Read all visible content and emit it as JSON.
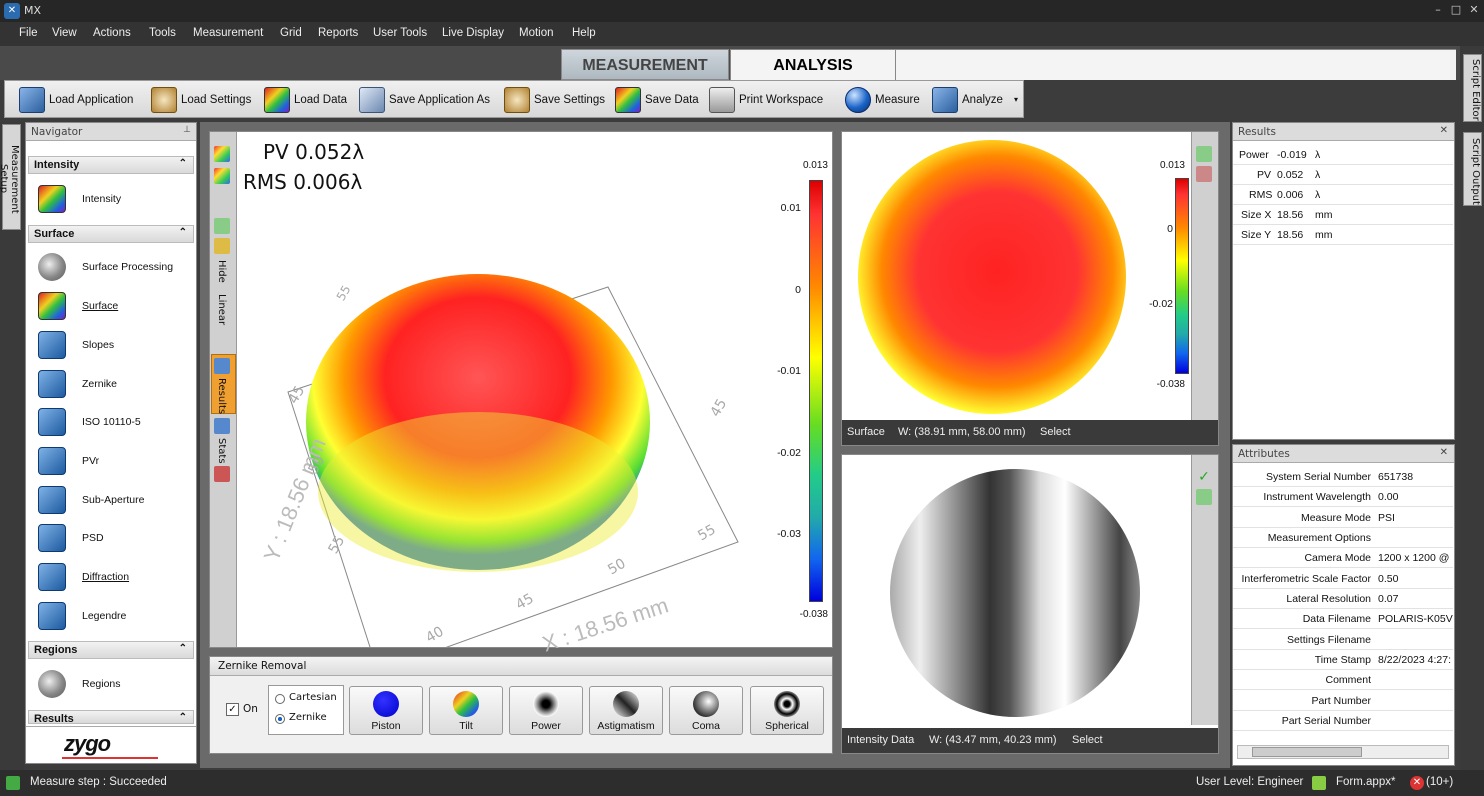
{
  "app": {
    "title": "MX",
    "window_controls": {
      "minimize": "–",
      "restore": "□",
      "close": "✕"
    }
  },
  "menu": [
    "File",
    "View",
    "Actions",
    "Tools",
    "Measurement",
    "Grid",
    "Reports",
    "User Tools",
    "Live Display",
    "Motion",
    "Help"
  ],
  "main_tabs": [
    {
      "label": "MEASUREMENT",
      "active": false
    },
    {
      "label": "ANALYSIS",
      "active": true
    }
  ],
  "toolbar": {
    "load_application": "Load Application",
    "load_settings": "Load Settings",
    "load_data": "Load Data",
    "save_application_as": "Save Application As",
    "save_settings": "Save Settings",
    "save_data": "Save Data",
    "print_workspace": "Print Workspace",
    "measure": "Measure",
    "analyze": "Analyze"
  },
  "right_rail": {
    "script_editor": "Script Editor",
    "script_output": "Script Output"
  },
  "left_rail": {
    "measurement_setup": "Measurement Setup"
  },
  "navigator": {
    "title": "Navigator",
    "intensity_header": "Intensity",
    "intensity": "Intensity",
    "surface_header": "Surface",
    "surface_processing": "Surface Processing",
    "surface": "Surface",
    "slopes": "Slopes",
    "zernike": "Zernike",
    "iso": "ISO 10110-5",
    "pvr": "PVr",
    "sub_aperture": "Sub-Aperture",
    "psd": "PSD",
    "diffraction": "Diffraction",
    "legendre": "Legendre",
    "regions_header": "Regions",
    "regions": "Regions",
    "results_header": "Results",
    "logo": "zygo"
  },
  "plot3d": {
    "pv": "PV 0.052λ",
    "rms": "RMS 0.006λ",
    "strip_hide": "Hide",
    "strip_linear": "Linear",
    "strip_results": "Results",
    "strip_stats": "Stats",
    "y_axis_label": "Y : 18.56 mm",
    "x_axis_label": "X : 18.56 mm",
    "y_ticks": [
      "45",
      "50",
      "55"
    ],
    "x_ticks": [
      "40",
      "45",
      "50",
      "55"
    ],
    "right_ticks": [
      "45"
    ],
    "top_tick": "55"
  },
  "colorbar_large": {
    "max": "0.013",
    "min": "-0.038",
    "ticks": [
      "0.01",
      "0",
      "-0.01",
      "-0.02",
      "-0.03"
    ]
  },
  "colorbar_small": {
    "max": "0.013",
    "min": "-0.038",
    "ticks": [
      "0",
      "-0.02"
    ]
  },
  "surface_view": {
    "label": "Surface",
    "dims": "W: (38.91 mm, 58.00 mm)",
    "mode": "Select"
  },
  "intensity_view": {
    "label": "Intensity Data",
    "dims": "W: (43.47 mm, 40.23 mm)",
    "mode": "Select"
  },
  "zernike": {
    "title": "Zernike Removal",
    "on_label": "On",
    "on_checked": true,
    "cartesian": "Cartesian",
    "zernike_opt": "Zernike",
    "buttons": [
      "Piston",
      "Tilt",
      "Power",
      "Astigmatism",
      "Coma",
      "Spherical"
    ]
  },
  "results": {
    "title": "Results",
    "rows": [
      {
        "k": "Power",
        "v": "-0.019",
        "u": "λ"
      },
      {
        "k": "PV",
        "v": "0.052",
        "u": "λ"
      },
      {
        "k": "RMS",
        "v": "0.006",
        "u": "λ"
      },
      {
        "k": "Size X",
        "v": "18.56",
        "u": "mm"
      },
      {
        "k": "Size Y",
        "v": "18.56",
        "u": "mm"
      }
    ]
  },
  "attributes": {
    "title": "Attributes",
    "rows": [
      {
        "k": "System Serial Number",
        "v": "651738"
      },
      {
        "k": "Instrument Wavelength",
        "v": "0.00"
      },
      {
        "k": "Measure Mode",
        "v": "PSI"
      },
      {
        "k": "Measurement Options",
        "v": ""
      },
      {
        "k": "Camera Mode",
        "v": "1200 x 1200 @"
      },
      {
        "k": "Interferometric Scale Factor",
        "v": "0.50"
      },
      {
        "k": "Lateral Resolution",
        "v": "0.07"
      },
      {
        "k": "Data Filename",
        "v": "POLARIS-K05VS."
      },
      {
        "k": "Settings Filename",
        "v": ""
      },
      {
        "k": "Time Stamp",
        "v": "8/22/2023 4:27:"
      },
      {
        "k": "Comment",
        "v": ""
      },
      {
        "k": "Part Number",
        "v": ""
      },
      {
        "k": "Part Serial Number",
        "v": ""
      }
    ]
  },
  "status": {
    "message": "Measure step : Succeeded",
    "user_level": "User Level: Engineer",
    "form": "Form.appx*",
    "errors": "(10+)"
  },
  "colors": {
    "accent_tab": "#f0a030",
    "panel_bg": "#ffffff",
    "chrome": "#3a3a3a"
  }
}
